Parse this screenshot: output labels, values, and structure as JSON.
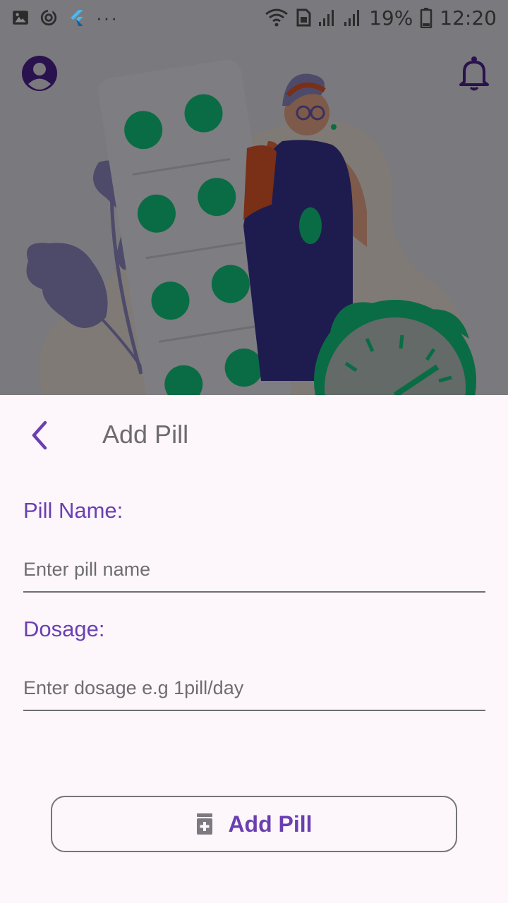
{
  "status_bar": {
    "icons_left": [
      "image-icon",
      "sync-icon",
      "flutter-icon",
      "more-icon"
    ],
    "more_glyph": "···",
    "battery": "19%",
    "time": "12:20"
  },
  "header": {
    "profile_icon": "account-circle-icon",
    "bell_icon": "bell-icon"
  },
  "sheet": {
    "title": "Add Pill",
    "back_icon": "chevron-left-icon",
    "pill_name": {
      "label": "Pill Name:",
      "placeholder": "Enter pill name",
      "value": ""
    },
    "dosage": {
      "label": "Dosage:",
      "placeholder": "Enter dosage e.g 1pill/day",
      "value": ""
    },
    "submit": {
      "label": "Add Pill",
      "icon": "medication-icon"
    }
  },
  "colors": {
    "accent": "#6a3fb0",
    "overlay": "#7a797d",
    "sheet_bg": "#fdf7fc",
    "pill_green": "#0b7a4b"
  }
}
